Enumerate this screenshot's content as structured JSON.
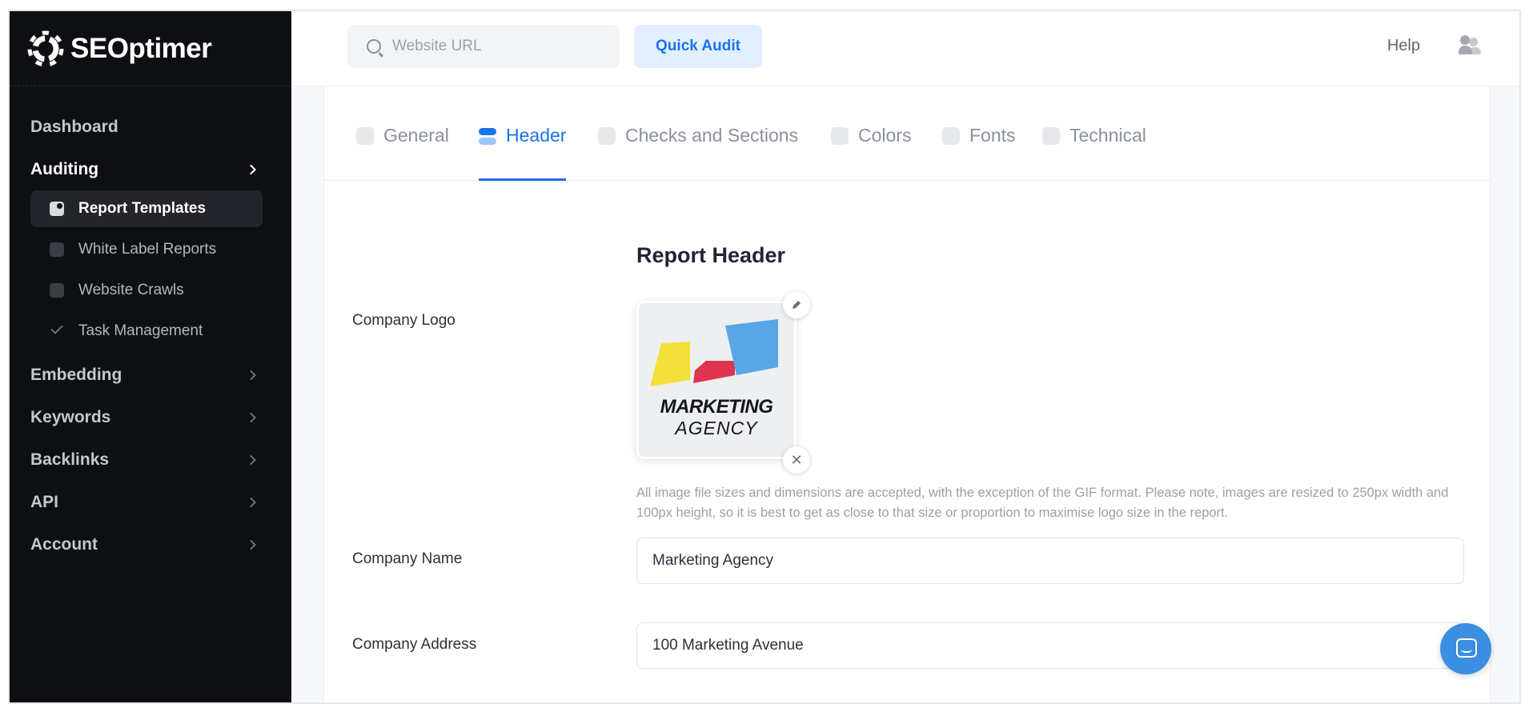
{
  "brand": {
    "name": "SEOptimer"
  },
  "topbar": {
    "search_placeholder": "Website URL",
    "quick_audit_label": "Quick Audit",
    "help_label": "Help"
  },
  "sidebar": {
    "items": [
      {
        "label": "Dashboard"
      },
      {
        "label": "Auditing"
      },
      {
        "label": "Embedding"
      },
      {
        "label": "Keywords"
      },
      {
        "label": "Backlinks"
      },
      {
        "label": "API"
      },
      {
        "label": "Account"
      }
    ],
    "auditing_sub": [
      {
        "label": "Report Templates",
        "active": true
      },
      {
        "label": "White Label Reports"
      },
      {
        "label": "Website Crawls"
      },
      {
        "label": "Task Management"
      }
    ]
  },
  "tabs": [
    {
      "label": "General"
    },
    {
      "label": "Header",
      "active": true
    },
    {
      "label": "Checks and Sections"
    },
    {
      "label": "Colors"
    },
    {
      "label": "Fonts"
    },
    {
      "label": "Technical"
    }
  ],
  "form": {
    "section_title": "Report Header",
    "company_logo_label": "Company Logo",
    "logo_text_main": "MARKETING",
    "logo_text_sub": "AGENCY",
    "hint": "All image file sizes and dimensions are accepted, with the exception of the GIF format. Please note, images are resized to 250px width and 100px height, so it is best to get as close to that size or proportion to maximise logo size in the report.",
    "company_name_label": "Company Name",
    "company_name_value": "Marketing Agency",
    "company_address_label": "Company Address",
    "company_address_value": "100 Marketing Avenue"
  },
  "colors": {
    "accent": "#1a73e8",
    "sidebar_bg": "#0e0f13",
    "logo_yellow": "#f4df3c",
    "logo_red": "#e0334f",
    "logo_blue": "#5aa5e6"
  }
}
